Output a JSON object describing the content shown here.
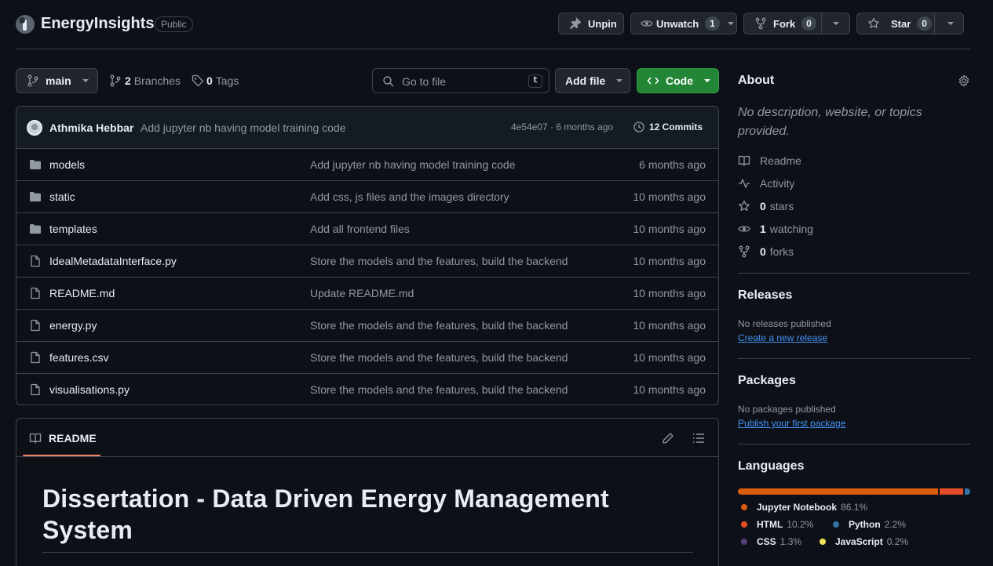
{
  "repo": {
    "name": "EnergyInsights",
    "visibility": "Public"
  },
  "actions": {
    "unpin": "Unpin",
    "unwatch": "Unwatch",
    "watch_count": "1",
    "fork": "Fork",
    "fork_count": "0",
    "star": "Star",
    "star_count": "0"
  },
  "toolbar": {
    "branch": "main",
    "branches_count": "2",
    "branches_label": "Branches",
    "tags_count": "0",
    "tags_label": "Tags",
    "search_placeholder": "Go to file",
    "search_key": "t",
    "add_file": "Add file",
    "code": "Code"
  },
  "commit": {
    "author": "Athmika Hebbar",
    "message": "Add jupyter nb having model training code",
    "sha_time": "4e54e07 · 6 months ago",
    "commits_label": "12 Commits"
  },
  "files": [
    {
      "type": "folder",
      "name": "models",
      "message": "Add jupyter nb having model training code",
      "date": "6 months ago"
    },
    {
      "type": "folder",
      "name": "static",
      "message": "Add css, js files and the images directory",
      "date": "10 months ago"
    },
    {
      "type": "folder",
      "name": "templates",
      "message": "Add all frontend files",
      "date": "10 months ago"
    },
    {
      "type": "file",
      "name": "IdealMetadataInterface.py",
      "message": "Store the models and the features, build the backend",
      "date": "10 months ago"
    },
    {
      "type": "file",
      "name": "README.md",
      "message": "Update README.md",
      "date": "10 months ago"
    },
    {
      "type": "file",
      "name": "energy.py",
      "message": "Store the models and the features, build the backend",
      "date": "10 months ago"
    },
    {
      "type": "file",
      "name": "features.csv",
      "message": "Store the models and the features, build the backend",
      "date": "10 months ago"
    },
    {
      "type": "file",
      "name": "visualisations.py",
      "message": "Store the models and the features, build the backend",
      "date": "10 months ago"
    }
  ],
  "readme": {
    "tab": "README",
    "heading": "Dissertation - Data Driven Energy Management System"
  },
  "about": {
    "title": "About",
    "description": "No description, website, or topics provided.",
    "readme": "Readme",
    "activity": "Activity",
    "stars_count": "0",
    "stars_label": "stars",
    "watching_count": "1",
    "watching_label": "watching",
    "forks_count": "0",
    "forks_label": "forks"
  },
  "releases": {
    "title": "Releases",
    "empty": "No releases published",
    "link": "Create a new release"
  },
  "packages": {
    "title": "Packages",
    "empty": "No packages published",
    "link": "Publish your first package"
  },
  "languages": {
    "title": "Languages",
    "items": [
      {
        "name": "Jupyter Notebook",
        "pct": "86.1%",
        "color": "#DA5B0B"
      },
      {
        "name": "HTML",
        "pct": "10.2%",
        "color": "#e34c26"
      },
      {
        "name": "Python",
        "pct": "2.2%",
        "color": "#3572A5"
      },
      {
        "name": "CSS",
        "pct": "1.3%",
        "color": "#563d7c"
      },
      {
        "name": "JavaScript",
        "pct": "0.2%",
        "color": "#f1e05a"
      }
    ]
  }
}
